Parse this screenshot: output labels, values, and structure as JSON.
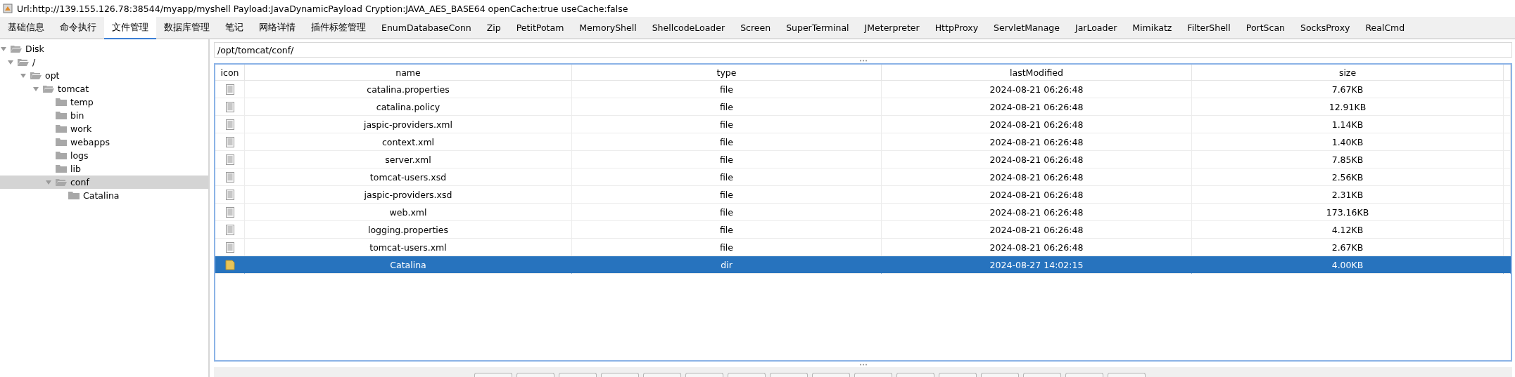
{
  "window": {
    "title": "Url:http://139.155.126.78:38544/myapp/myshell Payload:JavaDynamicPayload Cryption:JAVA_AES_BASE64 openCache:true useCache:false"
  },
  "tabs": [
    {
      "label": "基础信息",
      "selected": false
    },
    {
      "label": "命令执行",
      "selected": false
    },
    {
      "label": "文件管理",
      "selected": true
    },
    {
      "label": "数据库管理",
      "selected": false
    },
    {
      "label": "笔记",
      "selected": false
    },
    {
      "label": "网络详情",
      "selected": false
    },
    {
      "label": "插件标签管理",
      "selected": false
    },
    {
      "label": "EnumDatabaseConn",
      "selected": false
    },
    {
      "label": "Zip",
      "selected": false
    },
    {
      "label": "PetitPotam",
      "selected": false
    },
    {
      "label": "MemoryShell",
      "selected": false
    },
    {
      "label": "ShellcodeLoader",
      "selected": false
    },
    {
      "label": "Screen",
      "selected": false
    },
    {
      "label": "SuperTerminal",
      "selected": false
    },
    {
      "label": "JMeterpreter",
      "selected": false
    },
    {
      "label": "HttpProxy",
      "selected": false
    },
    {
      "label": "ServletManage",
      "selected": false
    },
    {
      "label": "JarLoader",
      "selected": false
    },
    {
      "label": "Mimikatz",
      "selected": false
    },
    {
      "label": "FilterShell",
      "selected": false
    },
    {
      "label": "PortScan",
      "selected": false
    },
    {
      "label": "SocksProxy",
      "selected": false
    },
    {
      "label": "RealCmd",
      "selected": false
    }
  ],
  "tree": {
    "label": "Disk",
    "expanded": true,
    "selected": false,
    "children": [
      {
        "label": "/",
        "expanded": true,
        "selected": false,
        "children": [
          {
            "label": "opt",
            "expanded": true,
            "selected": false,
            "children": [
              {
                "label": "tomcat",
                "expanded": true,
                "selected": false,
                "children": [
                  {
                    "label": "temp",
                    "expanded": false,
                    "selected": false
                  },
                  {
                    "label": "bin",
                    "expanded": false,
                    "selected": false
                  },
                  {
                    "label": "work",
                    "expanded": false,
                    "selected": false
                  },
                  {
                    "label": "webapps",
                    "expanded": false,
                    "selected": false
                  },
                  {
                    "label": "logs",
                    "expanded": false,
                    "selected": false
                  },
                  {
                    "label": "lib",
                    "expanded": false,
                    "selected": false
                  },
                  {
                    "label": "conf",
                    "expanded": true,
                    "selected": true,
                    "children": [
                      {
                        "label": "Catalina",
                        "expanded": false,
                        "selected": false
                      }
                    ]
                  }
                ]
              }
            ]
          }
        ]
      }
    ]
  },
  "path": {
    "value": "/opt/tomcat/conf/"
  },
  "table": {
    "columns": [
      "icon",
      "name",
      "type",
      "lastModified",
      "size"
    ],
    "rows": [
      {
        "kind": "file",
        "name": "catalina.properties",
        "type": "file",
        "lastModified": "2024-08-21 06:26:48",
        "size": "7.67KB",
        "selected": false
      },
      {
        "kind": "file",
        "name": "catalina.policy",
        "type": "file",
        "lastModified": "2024-08-21 06:26:48",
        "size": "12.91KB",
        "selected": false
      },
      {
        "kind": "file",
        "name": "jaspic-providers.xml",
        "type": "file",
        "lastModified": "2024-08-21 06:26:48",
        "size": "1.14KB",
        "selected": false
      },
      {
        "kind": "file",
        "name": "context.xml",
        "type": "file",
        "lastModified": "2024-08-21 06:26:48",
        "size": "1.40KB",
        "selected": false
      },
      {
        "kind": "file",
        "name": "server.xml",
        "type": "file",
        "lastModified": "2024-08-21 06:26:48",
        "size": "7.85KB",
        "selected": false
      },
      {
        "kind": "file",
        "name": "tomcat-users.xsd",
        "type": "file",
        "lastModified": "2024-08-21 06:26:48",
        "size": "2.56KB",
        "selected": false
      },
      {
        "kind": "file",
        "name": "jaspic-providers.xsd",
        "type": "file",
        "lastModified": "2024-08-21 06:26:48",
        "size": "2.31KB",
        "selected": false
      },
      {
        "kind": "file",
        "name": "web.xml",
        "type": "file",
        "lastModified": "2024-08-21 06:26:48",
        "size": "173.16KB",
        "selected": false
      },
      {
        "kind": "file",
        "name": "logging.properties",
        "type": "file",
        "lastModified": "2024-08-21 06:26:48",
        "size": "4.12KB",
        "selected": false
      },
      {
        "kind": "file",
        "name": "tomcat-users.xml",
        "type": "file",
        "lastModified": "2024-08-21 06:26:48",
        "size": "2.67KB",
        "selected": false
      },
      {
        "kind": "dir",
        "name": "Catalina",
        "type": "dir",
        "lastModified": "2024-08-27 14:02:15",
        "size": "4.00KB",
        "selected": true
      }
    ]
  }
}
